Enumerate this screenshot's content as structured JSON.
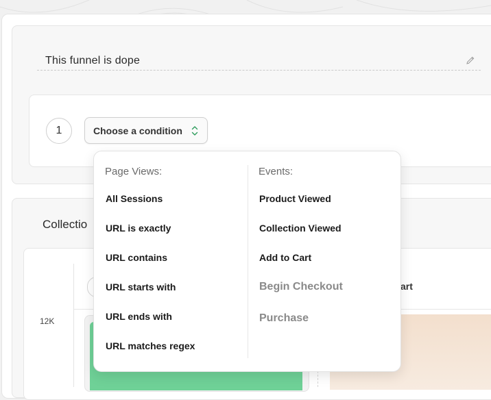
{
  "funnel": {
    "title": "This funnel is dope"
  },
  "step": {
    "number": "1",
    "condition_placeholder": "Choose a condition"
  },
  "results": {
    "collection_label": "Collectio",
    "y_tick": "12K",
    "column_2_label": "art"
  },
  "dropdown": {
    "page_views": {
      "heading": "Page Views:",
      "items": [
        "All Sessions",
        "URL is exactly",
        "URL contains",
        "URL starts with",
        "URL ends with",
        "URL matches regex"
      ]
    },
    "events": {
      "heading": "Events:",
      "items": [
        {
          "label": "Product Viewed",
          "enabled": true
        },
        {
          "label": "Collection Viewed",
          "enabled": true
        },
        {
          "label": "Add to Cart",
          "enabled": true
        },
        {
          "label": "Begin Checkout",
          "enabled": false
        },
        {
          "label": "Purchase",
          "enabled": false
        }
      ]
    }
  },
  "colors": {
    "bar_green": "#6fd197",
    "bar_peach": "#f3dfcd",
    "select_chevron": "#2e9c5c"
  }
}
